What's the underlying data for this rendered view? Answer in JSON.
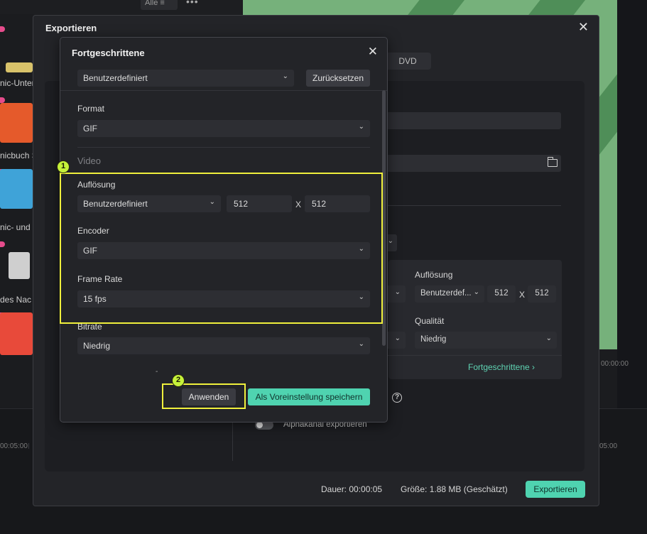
{
  "background": {
    "filter_label": "Alle",
    "sticker_labels": [
      "nic-Unter",
      "nicbuch S",
      "nic- und",
      "des Nac"
    ],
    "time_right": "00:00:00",
    "time_left": "00:05:00",
    "time_right2": "05:00"
  },
  "export_dialog": {
    "title": "Exportieren",
    "tab_dvd": "DVD",
    "resolution_label": "Auflösung",
    "resolution_value": "Benutzerdef...",
    "res_w": "512",
    "res_x": "X",
    "res_h": "512",
    "quality_label": "Qualität",
    "quality_value": "Niedrig",
    "advanced_link": "Fortgeschrittene",
    "alpha_label": "Alphakanal exportieren",
    "duration_label": "Dauer:",
    "duration_value": "00:00:05",
    "size_label": "Größe:",
    "size_value": "1.88 MB",
    "size_note": "(Geschätzt)",
    "export_button": "Exportieren"
  },
  "advanced_dialog": {
    "title": "Fortgeschrittene",
    "preset_value": "Benutzerdefiniert",
    "reset_button": "Zurücksetzen",
    "format_label": "Format",
    "format_value": "GIF",
    "video_section": "Video",
    "resolution_label": "Auflösung",
    "resolution_value": "Benutzerdefiniert",
    "res_w": "512",
    "res_x": "X",
    "res_h": "512",
    "encoder_label": "Encoder",
    "encoder_value": "GIF",
    "framerate_label": "Frame Rate",
    "framerate_value": "15 fps",
    "bitrate_label": "Bitrate",
    "bitrate_value": "Niedrig",
    "dash": "-",
    "apply_button": "Anwenden",
    "save_preset_button": "Als Voreinstellung speichern"
  },
  "annotations": {
    "badge1": "1",
    "badge2": "2"
  },
  "colors": {
    "accent": "#4fd3b0",
    "highlight": "#f0f03c",
    "badge": "#c6f23a"
  }
}
